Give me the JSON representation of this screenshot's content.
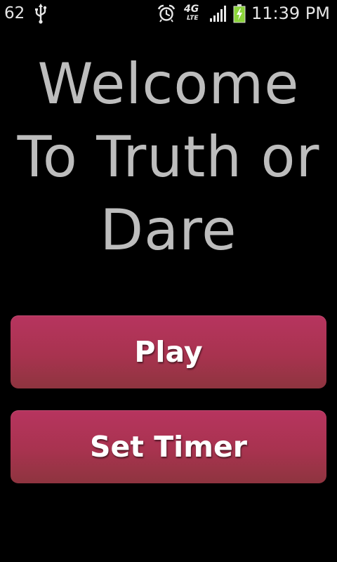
{
  "status_bar": {
    "left_number": "62",
    "network_label": "4G",
    "network_sublabel": "LTE",
    "time": "11:39 PM",
    "icons": [
      "usb-icon",
      "alarm-icon",
      "signal-icon",
      "battery-charging-icon"
    ],
    "battery_color": "#8bd43a"
  },
  "heading": {
    "line1": "Welcome",
    "line2": "To Truth or",
    "line3": "Dare"
  },
  "buttons": {
    "play_label": "Play",
    "set_timer_label": "Set Timer"
  },
  "colors": {
    "background": "#000000",
    "heading_text": "#bdbdbd",
    "button_top": "#b7345f",
    "button_bottom": "#8e343f",
    "button_text": "#ffffff"
  }
}
